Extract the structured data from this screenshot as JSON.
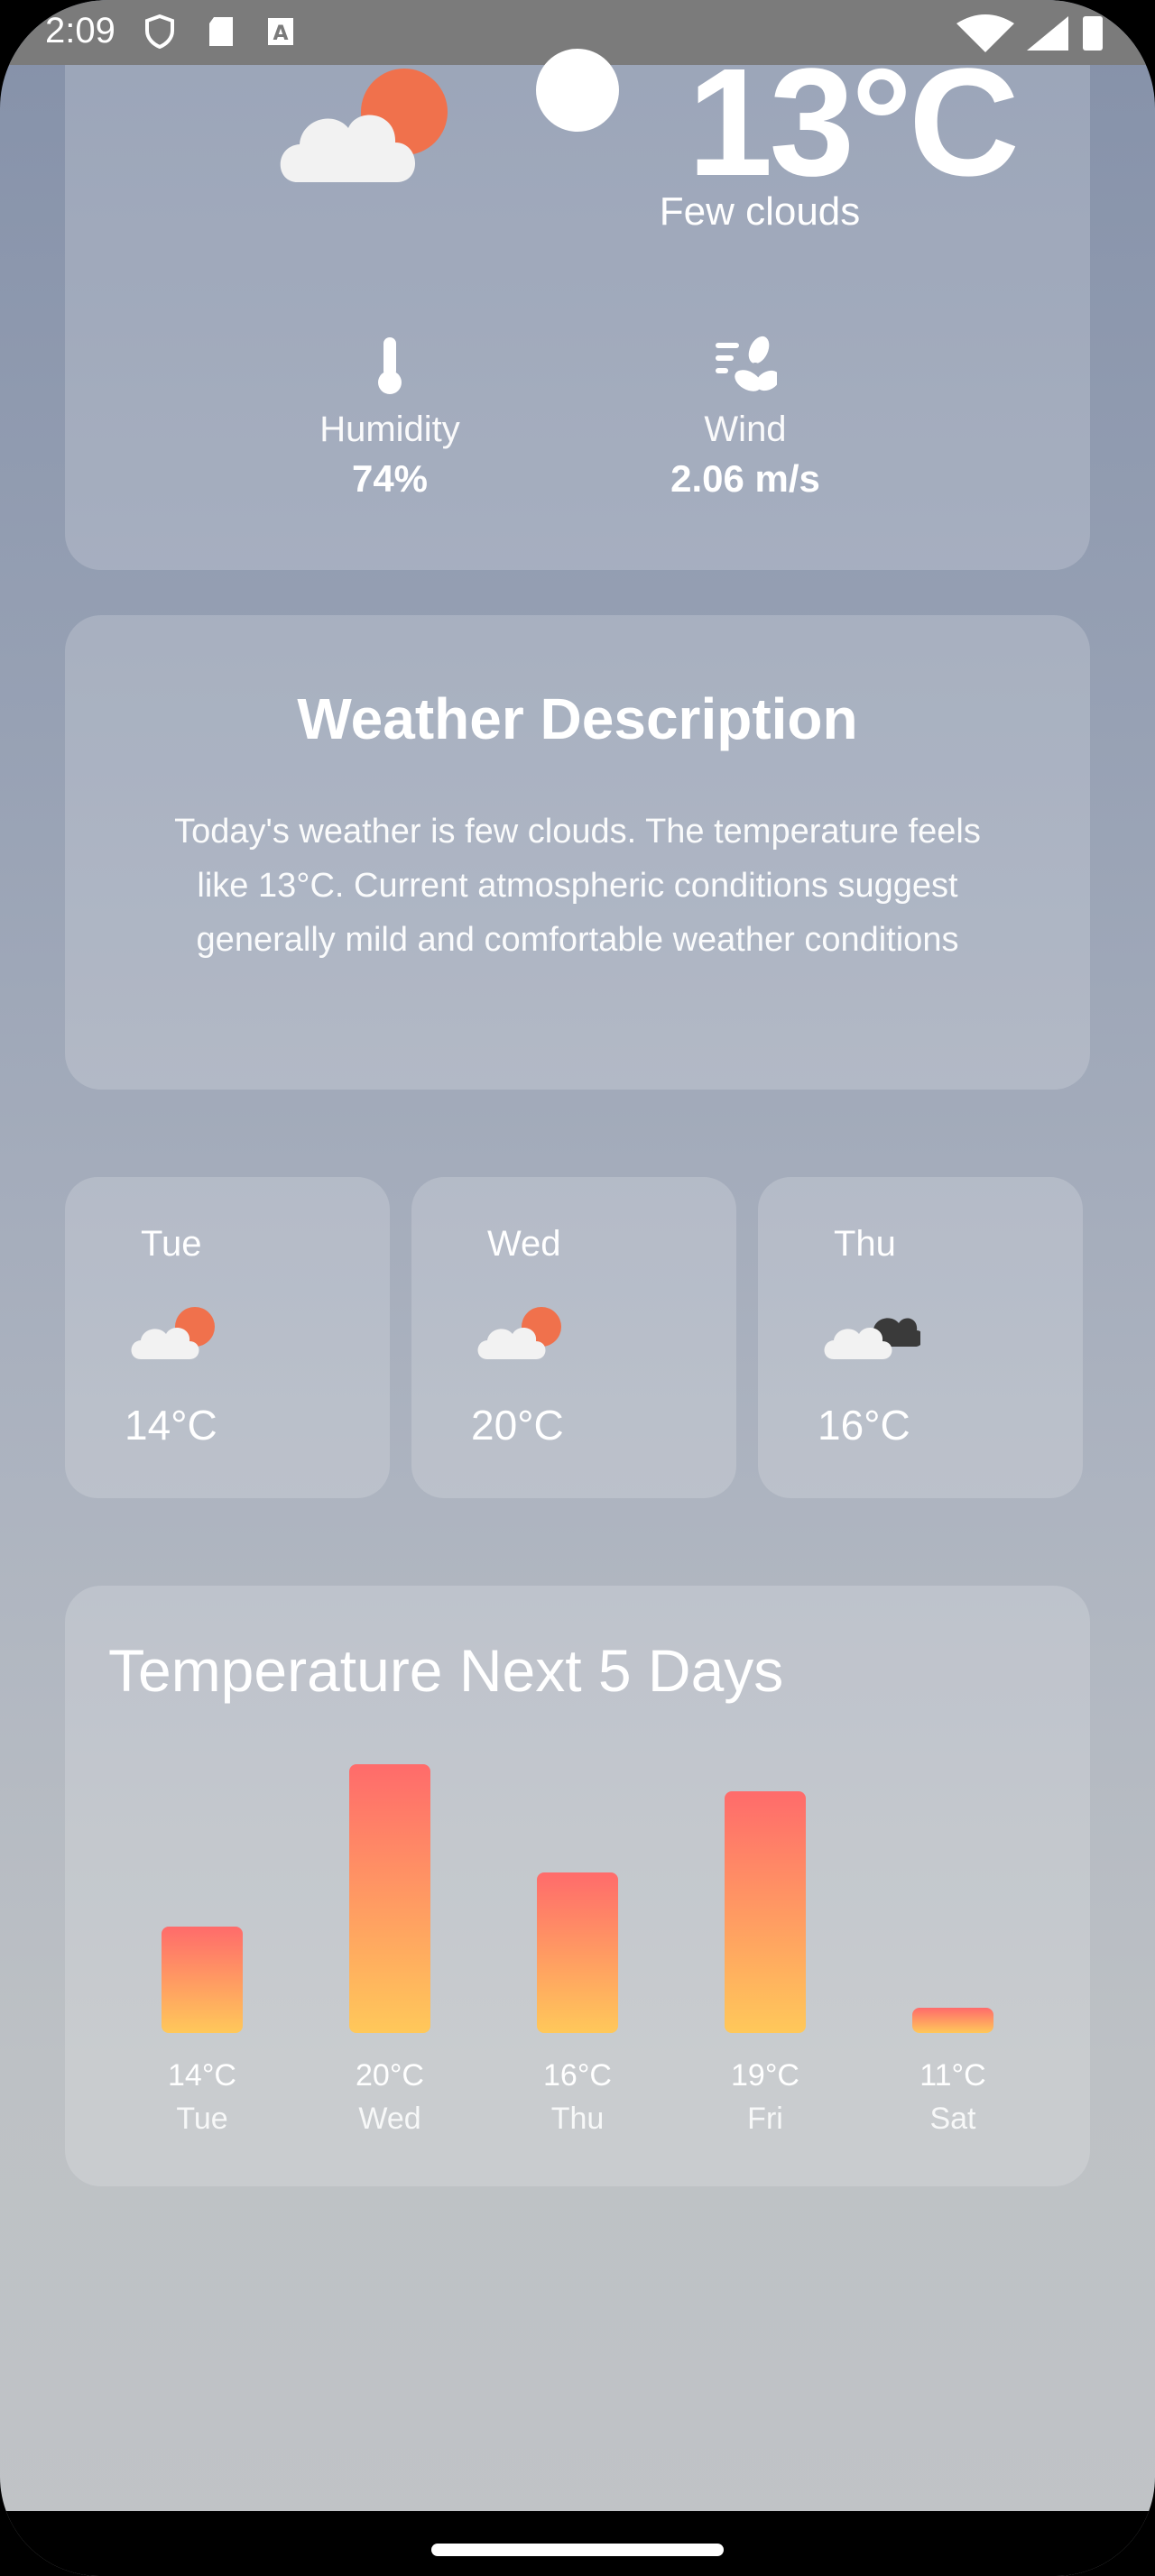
{
  "status": {
    "time": "2:09"
  },
  "current": {
    "temperature": "13°C",
    "condition": "Few clouds",
    "humidity_label": "Humidity",
    "humidity_value": "74%",
    "wind_label": "Wind",
    "wind_value": "2.06 m/s"
  },
  "description": {
    "title": "Weather Description",
    "text": "Today's weather is few clouds. The temperature feels like 13°C. Current atmospheric conditions suggest generally mild and comfortable weather conditions"
  },
  "forecast": [
    {
      "day": "Tue",
      "temp": "14°C",
      "icon": "cloud-sun-icon"
    },
    {
      "day": "Wed",
      "temp": "20°C",
      "icon": "cloud-sun-icon"
    },
    {
      "day": "Thu",
      "temp": "16°C",
      "icon": "dark-clouds-icon"
    }
  ],
  "chart_title": "Temperature Next 5 Days",
  "chart_data": {
    "type": "bar",
    "title": "Temperature Next 5 Days",
    "categories": [
      "Tue",
      "Wed",
      "Thu",
      "Fri",
      "Sat"
    ],
    "values": [
      14,
      20,
      16,
      19,
      11
    ],
    "value_labels": [
      "14°C",
      "20°C",
      "16°C",
      "19°C",
      "11°C"
    ],
    "unit": "°C",
    "bar_gradient": [
      "#ff6b6b",
      "#ffc85a"
    ]
  },
  "colors": {
    "sun": "#f0714c",
    "cloud": "#f2f2f2",
    "dark_cloud": "#3a3a3a"
  }
}
